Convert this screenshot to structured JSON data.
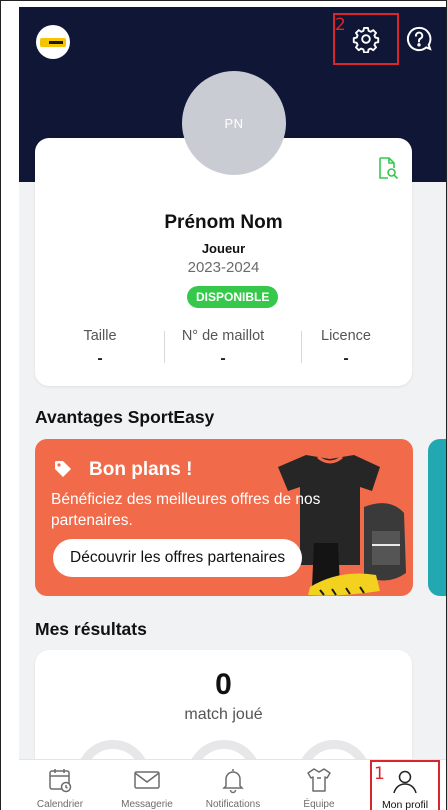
{
  "header": {
    "avatar_initials": "PN",
    "annotation_settings": "2"
  },
  "profile": {
    "name": "Prénom Nom",
    "role": "Joueur",
    "season": "2023-2024",
    "status": "DISPONIBLE",
    "stats": [
      {
        "label": "Taille",
        "value": "-"
      },
      {
        "label": "N° de maillot",
        "value": "-"
      },
      {
        "label": "Licence",
        "value": "-"
      }
    ]
  },
  "advantages": {
    "section_title": "Avantages SportEasy",
    "promo": {
      "title": "Bon plans !",
      "description": "Bénéficiez des meilleures offres de nos partenaires.",
      "cta": "Découvrir les offres partenaires"
    }
  },
  "results": {
    "section_title": "Mes résultats",
    "matches_count": "0",
    "matches_label": "match joué"
  },
  "tabbar": {
    "items": [
      {
        "label": "Calendrier",
        "icon": "calendar-icon"
      },
      {
        "label": "Messagerie",
        "icon": "mail-icon"
      },
      {
        "label": "Notifications",
        "icon": "bell-icon"
      },
      {
        "label": "Équipe",
        "icon": "jersey-icon"
      },
      {
        "label": "Mon profil",
        "icon": "user-icon"
      }
    ],
    "annotation_profile": "1"
  },
  "colors": {
    "header_bg": "#0f1636",
    "accent_annotation": "#d9252b",
    "status_green": "#35c84b",
    "promo_orange": "#f16a49"
  }
}
